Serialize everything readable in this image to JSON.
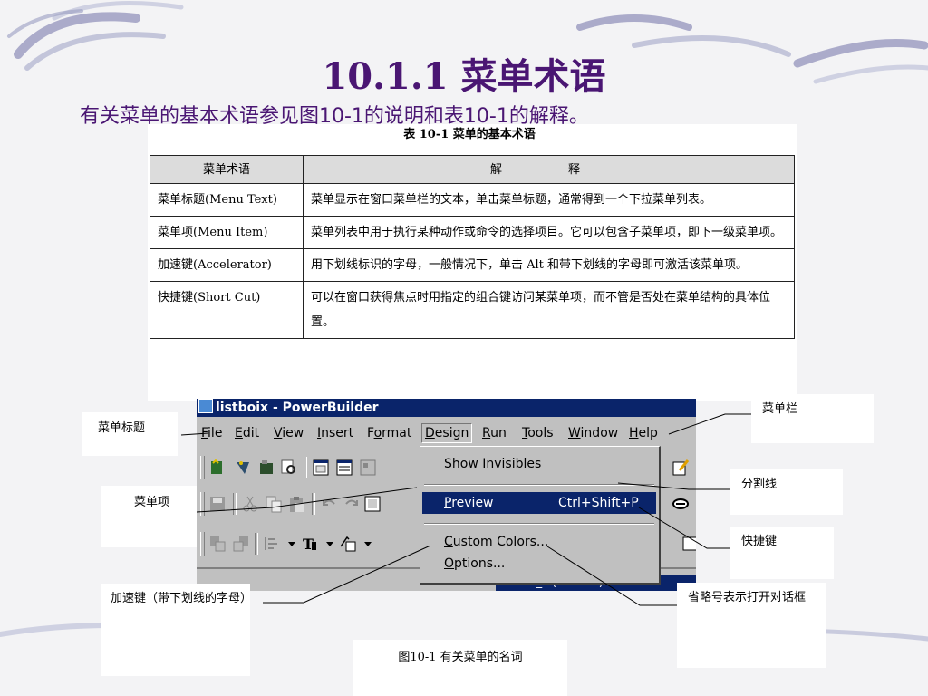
{
  "slide": {
    "title": "10.1.1 菜单术语",
    "subtitle": "有关菜单的基本术语参见图10-1的说明和表10-1的解释。"
  },
  "table": {
    "caption": "表 10-1  菜单的基本术语",
    "headers": [
      "菜单术语",
      "解　释"
    ],
    "rows": [
      {
        "term": "菜单标题(Menu Text)",
        "explanation": "菜单显示在窗口菜单栏的文本，单击菜单标题，通常得到一个下拉菜单列表。"
      },
      {
        "term": "菜单项(Menu Item)",
        "explanation": "菜单列表中用于执行某种动作或命令的选择项目。它可以包含子菜单项，即下一级菜单项。"
      },
      {
        "term": "加速键(Accelerator)",
        "explanation": "用下划线标识的字母，一般情况下，单击 Alt 和带下划线的字母即可激活该菜单项。"
      },
      {
        "term": "快捷键(Short Cut)",
        "explanation": "可以在窗口获得焦点时用指定的组合键访问某菜单项，而不管是否处在菜单结构的具体位置。"
      }
    ]
  },
  "screenshot": {
    "window_title": "listboix - PowerBuilder",
    "menubar": [
      {
        "pre": "",
        "key": "F",
        "post": "ile"
      },
      {
        "pre": "",
        "key": "E",
        "post": "dit"
      },
      {
        "pre": "",
        "key": "V",
        "post": "iew"
      },
      {
        "pre": "",
        "key": "I",
        "post": "nsert"
      },
      {
        "pre": "F",
        "key": "o",
        "post": "rmat"
      },
      {
        "pre": "",
        "key": "D",
        "post": "esign"
      },
      {
        "pre": "",
        "key": "R",
        "post": "un"
      },
      {
        "pre": "",
        "key": "T",
        "post": "ools"
      },
      {
        "pre": "",
        "key": "W",
        "post": "indow"
      },
      {
        "pre": "",
        "key": "H",
        "post": "elp"
      }
    ],
    "dropdown": {
      "show_invisibles": "Show Invisibles",
      "preview": {
        "key": "P",
        "rest": "review",
        "shortcut": "Ctrl+Shift+P"
      },
      "custom_colors": {
        "key": "C",
        "rest": "ustom Colors..."
      },
      "options": {
        "key": "O",
        "rest": "ptions..."
      }
    },
    "bottom_text": "w_s (listboix) x"
  },
  "callouts": {
    "menu_title": "菜单标题",
    "menu_bar": "菜单栏",
    "separator": "分割线",
    "menu_item": "菜单项",
    "shortcut": "快捷键",
    "accelerator": "加速键（带下划线的字母）",
    "ellipsis": "省略号表示打开对话框"
  },
  "figure_caption": "图10-1 有关菜单的名词",
  "colors": {
    "title": "#4a1673",
    "selection": "#0a246a",
    "background": "#f3f3f5"
  }
}
